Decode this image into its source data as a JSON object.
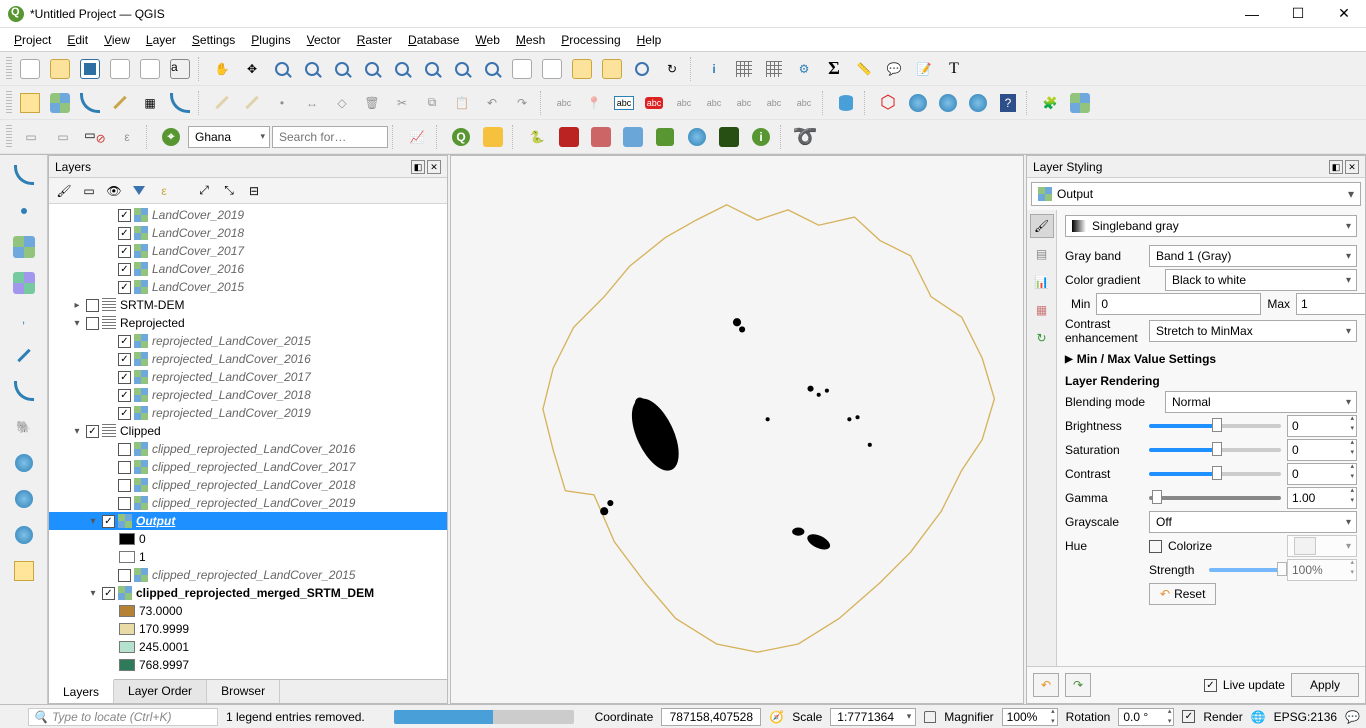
{
  "title": "*Untitled Project — QGIS",
  "menu": [
    "Project",
    "Edit",
    "View",
    "Layer",
    "Settings",
    "Plugins",
    "Vector",
    "Raster",
    "Database",
    "Web",
    "Mesh",
    "Processing",
    "Help"
  ],
  "toolbar_row3": {
    "country": "Ghana",
    "search_ph": "Search for…"
  },
  "panels": {
    "layers": {
      "title": "Layers",
      "tabs": [
        "Layers",
        "Layer Order",
        "Browser"
      ],
      "tree": [
        {
          "depth": 3,
          "chk": true,
          "ic": "raster",
          "label": "LandCover_2019",
          "cls": "italic"
        },
        {
          "depth": 3,
          "chk": true,
          "ic": "raster",
          "label": "LandCover_2018",
          "cls": "italic"
        },
        {
          "depth": 3,
          "chk": true,
          "ic": "raster",
          "label": "LandCover_2017",
          "cls": "italic"
        },
        {
          "depth": 3,
          "chk": true,
          "ic": "raster",
          "label": "LandCover_2016",
          "cls": "italic"
        },
        {
          "depth": 3,
          "chk": true,
          "ic": "raster",
          "label": "LandCover_2015",
          "cls": "italic"
        },
        {
          "depth": 1,
          "exp": "▸",
          "chk": false,
          "ic": "group",
          "label": "SRTM-DEM",
          "cls": "reg"
        },
        {
          "depth": 1,
          "exp": "▾",
          "chk": false,
          "ic": "group",
          "label": "Reprojected",
          "cls": "reg"
        },
        {
          "depth": 3,
          "chk": true,
          "ic": "raster",
          "label": "reprojected_LandCover_2015",
          "cls": "italic"
        },
        {
          "depth": 3,
          "chk": true,
          "ic": "raster",
          "label": "reprojected_LandCover_2016",
          "cls": "italic"
        },
        {
          "depth": 3,
          "chk": true,
          "ic": "raster",
          "label": "reprojected_LandCover_2017",
          "cls": "italic"
        },
        {
          "depth": 3,
          "chk": true,
          "ic": "raster",
          "label": "reprojected_LandCover_2018",
          "cls": "italic"
        },
        {
          "depth": 3,
          "chk": true,
          "ic": "raster",
          "label": "reprojected_LandCover_2019",
          "cls": "italic"
        },
        {
          "depth": 1,
          "exp": "▾",
          "chk": true,
          "ic": "group",
          "label": "Clipped",
          "cls": "reg"
        },
        {
          "depth": 3,
          "chk": false,
          "ic": "raster",
          "label": "clipped_reprojected_LandCover_2016",
          "cls": "italic"
        },
        {
          "depth": 3,
          "chk": false,
          "ic": "raster",
          "label": "clipped_reprojected_LandCover_2017",
          "cls": "italic"
        },
        {
          "depth": 3,
          "chk": false,
          "ic": "raster",
          "label": "clipped_reprojected_LandCover_2018",
          "cls": "italic"
        },
        {
          "depth": 3,
          "chk": false,
          "ic": "raster",
          "label": "clipped_reprojected_LandCover_2019",
          "cls": "italic"
        },
        {
          "depth": 2,
          "exp": "▾",
          "chk": true,
          "ic": "raster",
          "label": "Output",
          "cls": "selected"
        },
        {
          "depth": 4,
          "sw": "#000000",
          "label": "0",
          "cls": "reg"
        },
        {
          "depth": 4,
          "sw": "#ffffff",
          "label": "1",
          "cls": "reg"
        },
        {
          "depth": 3,
          "chk": false,
          "ic": "raster",
          "label": "clipped_reprojected_LandCover_2015",
          "cls": "italic"
        },
        {
          "depth": 2,
          "exp": "▾",
          "chk": true,
          "ic": "raster",
          "label": "clipped_reprojected_merged_SRTM_DEM",
          "cls": "bold"
        },
        {
          "depth": 4,
          "sw": "#b58135",
          "label": "73.0000",
          "cls": "reg"
        },
        {
          "depth": 4,
          "sw": "#e8dba6",
          "label": "170.9999",
          "cls": "reg"
        },
        {
          "depth": 4,
          "sw": "#b4e2cf",
          "label": "245.0001",
          "cls": "reg"
        },
        {
          "depth": 4,
          "sw": "#2f7a5a",
          "label": "768.9997",
          "cls": "reg"
        }
      ]
    },
    "styling": {
      "title": "Layer Styling",
      "target": "Output",
      "renderer": "Singleband gray",
      "gray_band_label": "Gray band",
      "gray_band": "Band 1 (Gray)",
      "color_gradient_label": "Color gradient",
      "color_gradient": "Black to white",
      "min_label": "Min",
      "min": "0",
      "max_label": "Max",
      "max": "1",
      "contrast_label": "Contrast enhancement",
      "contrast": "Stretch to MinMax",
      "minmax_header": "Min / Max Value Settings",
      "rendering_header": "Layer Rendering",
      "blending_label": "Blending mode",
      "blending": "Normal",
      "brightness_label": "Brightness",
      "brightness": "0",
      "saturation_label": "Saturation",
      "saturation": "0",
      "contrast2_label": "Contrast",
      "contrast2": "0",
      "gamma_label": "Gamma",
      "gamma": "1.00",
      "grayscale_label": "Grayscale",
      "grayscale": "Off",
      "hue_label": "Hue",
      "colorize_label": "Colorize",
      "strength_label": "Strength",
      "strength": "100%",
      "reset": "Reset",
      "live": "Live update",
      "apply": "Apply"
    }
  },
  "status": {
    "msg": "1 legend entries removed.",
    "progress_pct": 55,
    "coord_label": "Coordinate",
    "coord": "787158,407528",
    "scale_label": "Scale",
    "scale": "1:7771364",
    "magnifier_label": "Magnifier",
    "magnifier": "100%",
    "rotation_label": "Rotation",
    "rotation": "0.0 °",
    "render": "Render",
    "epsg": "EPSG:2136"
  },
  "locator_ph": "Type to locate (Ctrl+K)"
}
